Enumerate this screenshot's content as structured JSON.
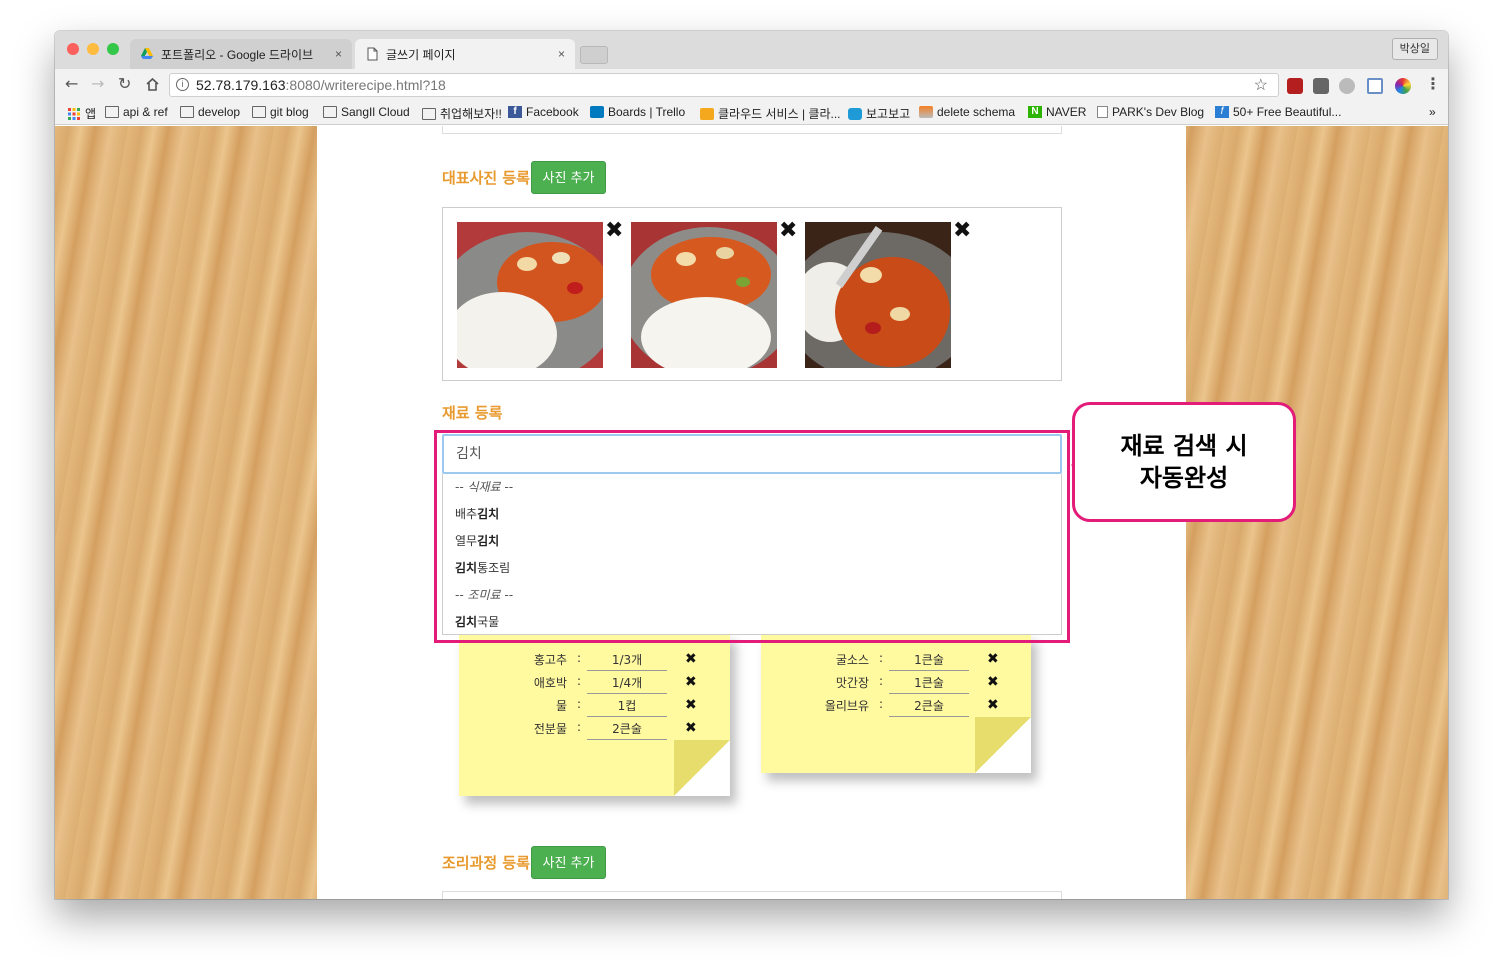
{
  "browser": {
    "tabs": [
      {
        "title": "포트폴리오 - Google 드라이브",
        "close": "×"
      },
      {
        "title": "글쓰기 페이지",
        "close": "×"
      }
    ],
    "profile_name": "박상일",
    "url_host": "52.78.179.163",
    "url_rest": ":8080/writerecipe.html?18"
  },
  "bookmarks": [
    {
      "label": "앱",
      "icon": "apps-grid-icon"
    },
    {
      "label": "api & ref",
      "icon": "folder-icon"
    },
    {
      "label": "develop",
      "icon": "folder-icon"
    },
    {
      "label": "git blog",
      "icon": "folder-icon"
    },
    {
      "label": "SangIl Cloud",
      "icon": "folder-icon"
    },
    {
      "label": "취업해보자!!",
      "icon": "folder-icon"
    },
    {
      "label": "Facebook",
      "icon": "facebook-icon"
    },
    {
      "label": "Boards | Trello",
      "icon": "trello-icon"
    },
    {
      "label": "클라우드 서비스 | 클라...",
      "icon": "box-icon"
    },
    {
      "label": "보고보고",
      "icon": "play-icon"
    },
    {
      "label": "delete schema",
      "icon": "stack-icon"
    },
    {
      "label": "NAVER",
      "icon": "naver-icon"
    },
    {
      "label": "PARK's Dev Blog",
      "icon": "page-icon"
    },
    {
      "label": "50+ Free Beautiful...",
      "icon": "f-icon"
    }
  ],
  "bookmarks_more": "»",
  "page": {
    "main_photo": {
      "title": "대표사진 등록",
      "button": "사진 추가",
      "delete": "✖"
    },
    "ingredients": {
      "title": "재료 등록",
      "search_value": "김치",
      "suggestions": [
        {
          "type": "group",
          "text": "-- 식재료 --"
        },
        {
          "type": "item",
          "pre": "배추",
          "match": "김치",
          "post": ""
        },
        {
          "type": "item",
          "pre": "열무",
          "match": "김치",
          "post": ""
        },
        {
          "type": "item",
          "pre": "",
          "match": "김치",
          "post": "통조림"
        },
        {
          "type": "group",
          "text": "-- 조미료 --"
        },
        {
          "type": "item",
          "pre": "",
          "match": "김치",
          "post": "국물"
        }
      ]
    },
    "note_left": [
      {
        "name": "홍고추",
        "colon": ":",
        "qty": "1/3개"
      },
      {
        "name": "애호박",
        "colon": ":",
        "qty": "1/4개"
      },
      {
        "name": "물",
        "colon": ":",
        "qty": "1컵"
      },
      {
        "name": "전분물",
        "colon": ":",
        "qty": "2큰술"
      }
    ],
    "note_right": [
      {
        "name": "굴소스",
        "colon": ":",
        "qty": "1큰술"
      },
      {
        "name": "맛간장",
        "colon": ":",
        "qty": "1큰술"
      },
      {
        "name": "올리브유",
        "colon": ":",
        "qty": "2큰술"
      }
    ],
    "steps": {
      "title": "조리과정 등록",
      "button": "사진 추가"
    }
  },
  "callout": {
    "line1": "재료 검색 시",
    "line2": "자동완성"
  },
  "colors": {
    "accent_title": "#e89a2f",
    "button_green": "#4caf50",
    "highlight": "#e31c79",
    "note": "#fff9a0"
  }
}
